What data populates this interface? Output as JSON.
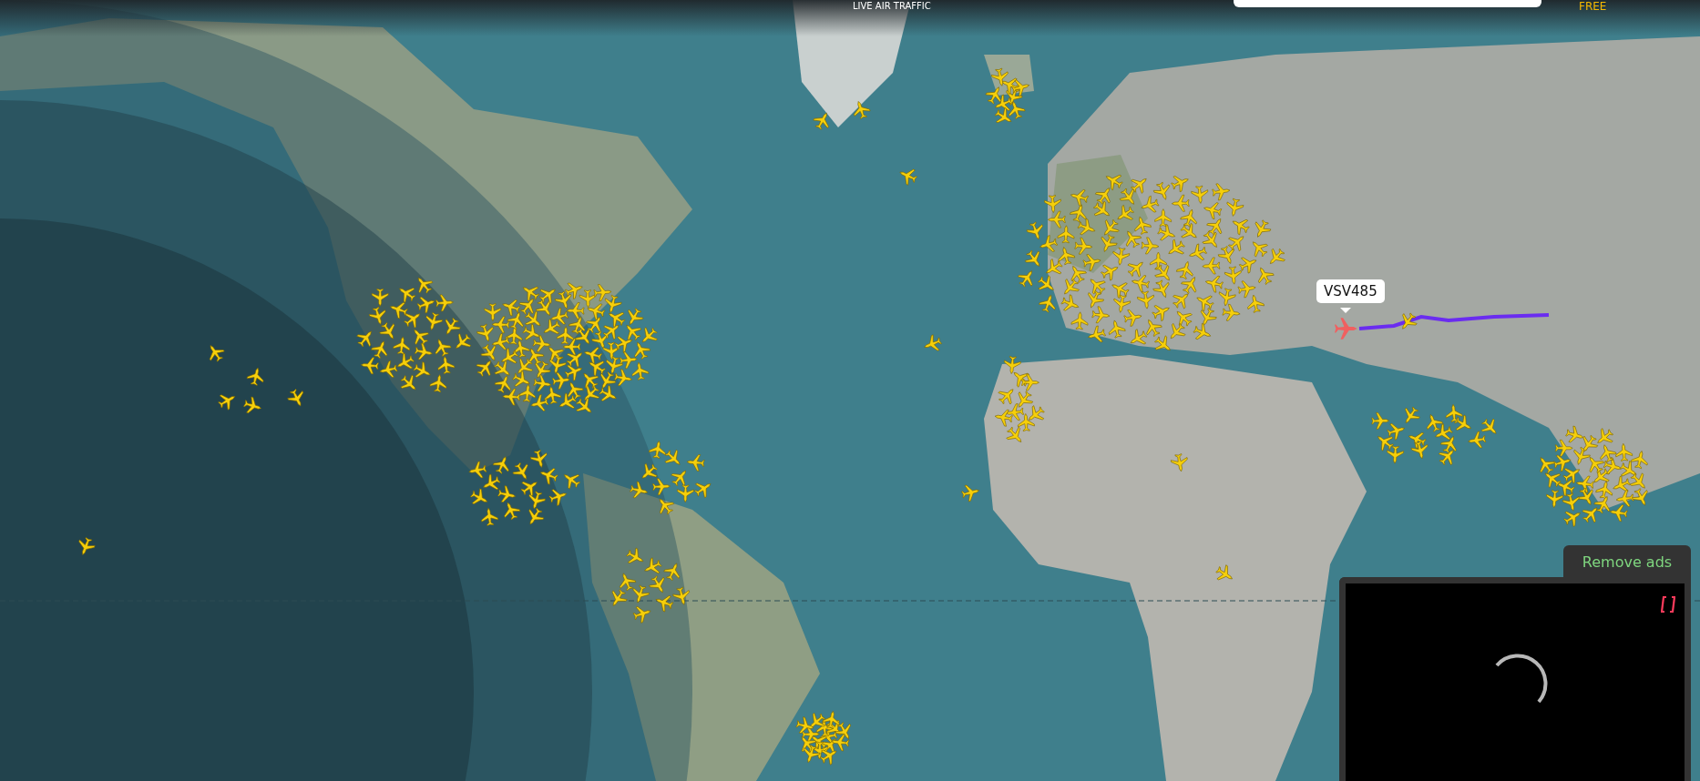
{
  "header": {
    "tagline": "LIVE AIR TRAFFIC",
    "badge": "FREE",
    "search": {
      "kind": "field"
    }
  },
  "selected_flight": {
    "callsign": "VSV485"
  },
  "ad": {
    "remove_button": "Remove ads",
    "loading": true
  }
}
